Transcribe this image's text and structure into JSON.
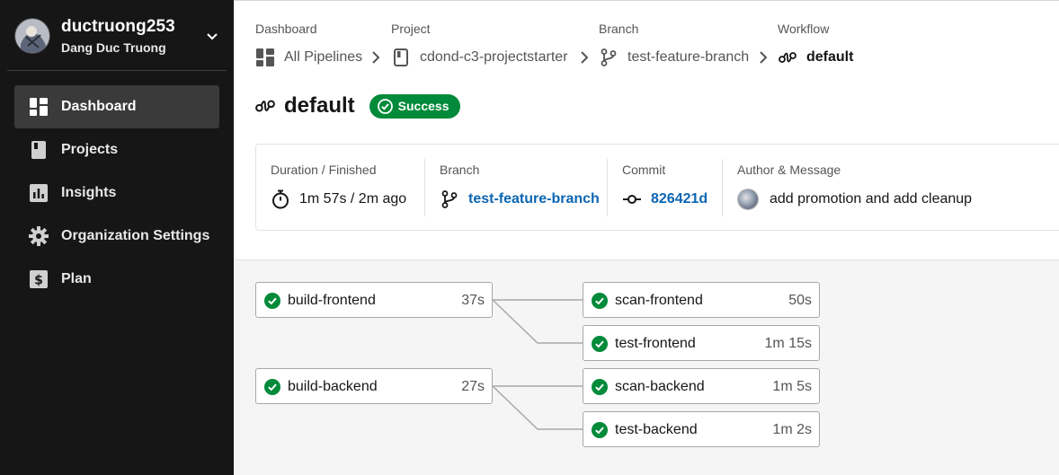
{
  "profile": {
    "username": "ductruong253",
    "full_name": "Dang Duc Truong",
    "avatar_icon": "avatar",
    "menu_icon": "chevron-down-icon"
  },
  "sidebar": {
    "items": [
      {
        "label": "Dashboard",
        "icon": "dashboard-icon",
        "active": true
      },
      {
        "label": "Projects",
        "icon": "projects-icon",
        "active": false
      },
      {
        "label": "Insights",
        "icon": "insights-icon",
        "active": false
      },
      {
        "label": "Organization Settings",
        "icon": "gear-icon",
        "active": false
      },
      {
        "label": "Plan",
        "icon": "dollar-icon",
        "active": false
      }
    ]
  },
  "breadcrumb": {
    "dashboard": {
      "label": "Dashboard",
      "value": "All Pipelines"
    },
    "project": {
      "label": "Project",
      "value": "cdond-c3-projectstarter"
    },
    "branch": {
      "label": "Branch",
      "value": "test-feature-branch"
    },
    "workflow": {
      "label": "Workflow",
      "value": "default"
    }
  },
  "workflow": {
    "title": "default",
    "status": "Success",
    "status_color": "#008a39"
  },
  "info": {
    "duration": {
      "label": "Duration / Finished",
      "value": "1m 57s / 2m ago"
    },
    "branch": {
      "label": "Branch",
      "value": "test-feature-branch"
    },
    "commit": {
      "label": "Commit",
      "value": "826421d"
    },
    "author": {
      "label": "Author & Message",
      "value": "add promotion and add cleanup"
    }
  },
  "jobs": {
    "build_frontend": {
      "name": "build-frontend",
      "time": "37s"
    },
    "scan_frontend": {
      "name": "scan-frontend",
      "time": "50s"
    },
    "test_frontend": {
      "name": "test-frontend",
      "time": "1m 15s"
    },
    "build_backend": {
      "name": "build-backend",
      "time": "27s"
    },
    "scan_backend": {
      "name": "scan-backend",
      "time": "1m 5s"
    },
    "test_backend": {
      "name": "test-backend",
      "time": "1m 2s"
    }
  },
  "colors": {
    "sidebar_bg": "#161616",
    "success": "#008a39",
    "link": "#0b66b3"
  }
}
